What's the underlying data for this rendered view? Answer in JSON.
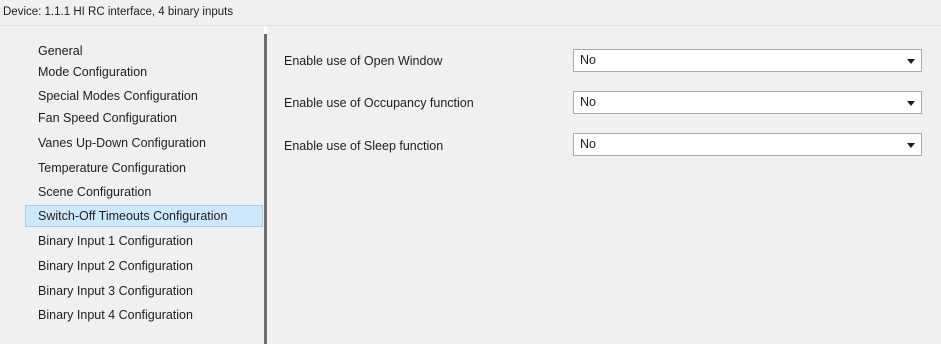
{
  "window": {
    "title": "Device: 1.1.1  HI RC interface, 4 binary inputs"
  },
  "sidebar": {
    "items": [
      {
        "label": "General",
        "selected": false
      },
      {
        "label": "Mode Configuration",
        "selected": false
      },
      {
        "label": "Special Modes Configuration",
        "selected": false
      },
      {
        "label": "Fan Speed Configuration",
        "selected": false
      },
      {
        "label": "Vanes Up-Down Configuration",
        "selected": false
      },
      {
        "label": "Temperature Configuration",
        "selected": false
      },
      {
        "label": "Scene Configuration",
        "selected": false
      },
      {
        "label": "Switch-Off Timeouts Configuration",
        "selected": true
      },
      {
        "label": "Binary Input 1 Configuration",
        "selected": false
      },
      {
        "label": "Binary Input 2 Configuration",
        "selected": false
      },
      {
        "label": "Binary Input 3 Configuration",
        "selected": false
      },
      {
        "label": "Binary Input 4 Configuration",
        "selected": false
      }
    ]
  },
  "settings": {
    "rows": [
      {
        "label": "Enable use of Open Window",
        "value": "No"
      },
      {
        "label": "Enable use of Occupancy function",
        "value": "No"
      },
      {
        "label": "Enable use of Sleep function",
        "value": "No"
      }
    ]
  },
  "colors": {
    "panel_background": "#f0f0f0",
    "selection_fill": "#cde8fa",
    "selection_border": "#9fd1f5",
    "splitter": "#6d6d6d"
  }
}
